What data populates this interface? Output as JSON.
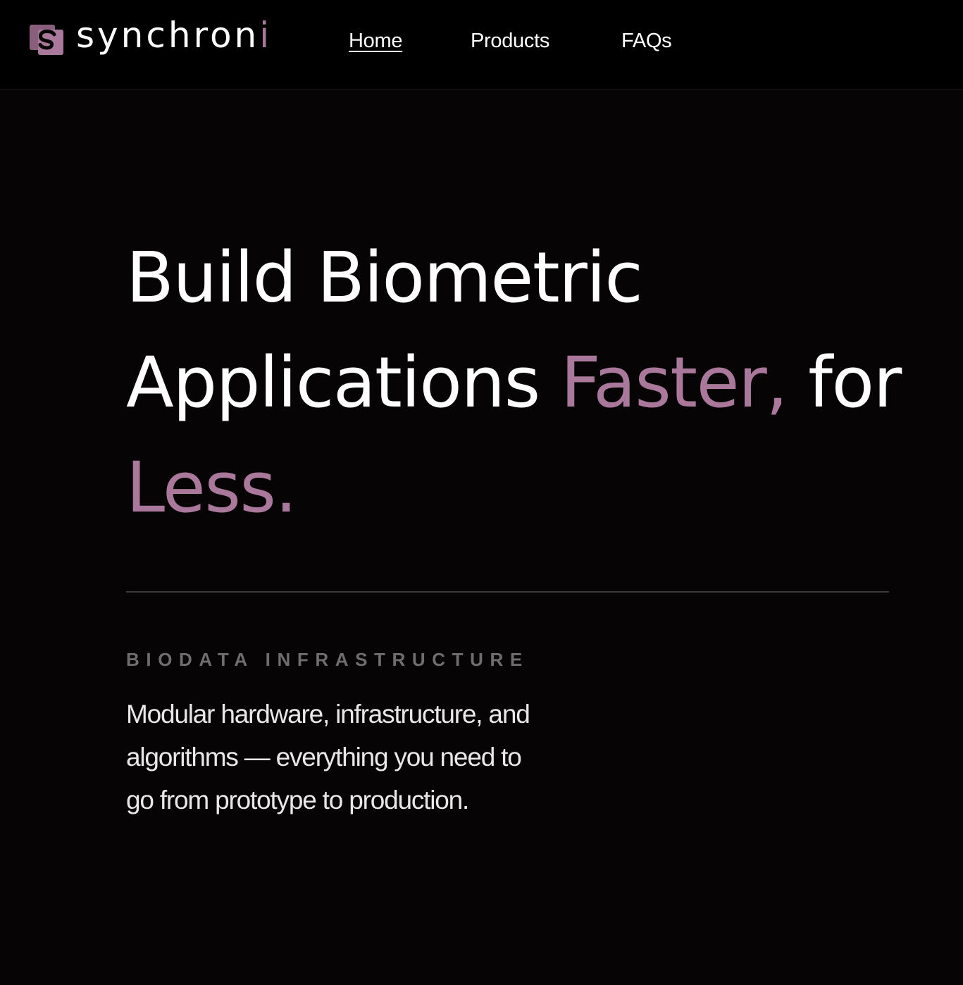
{
  "brand": {
    "name_main": "synchron",
    "name_accent": "i",
    "logo_icon": "synchroni-s-logo-icon",
    "accent_color": "#a9789a"
  },
  "nav": {
    "items": [
      {
        "label": "Home",
        "active": true
      },
      {
        "label": "Products",
        "active": false
      },
      {
        "label": "FAQs",
        "active": false
      }
    ]
  },
  "hero": {
    "title_part1": "Build Biometric Applications ",
    "title_highlight1": "Faster,",
    "title_part2": " for ",
    "title_highlight2": "Less."
  },
  "section": {
    "eyebrow": "BIODATA INFRASTRUCTURE",
    "description": "Modular hardware, infrastructure, and algorithms — everything you need to go from prototype to production."
  },
  "colors": {
    "background": "#060405",
    "navbar": "#000000",
    "text": "#ffffff",
    "highlight": "#a9789a",
    "muted": "#6f6d6e"
  }
}
